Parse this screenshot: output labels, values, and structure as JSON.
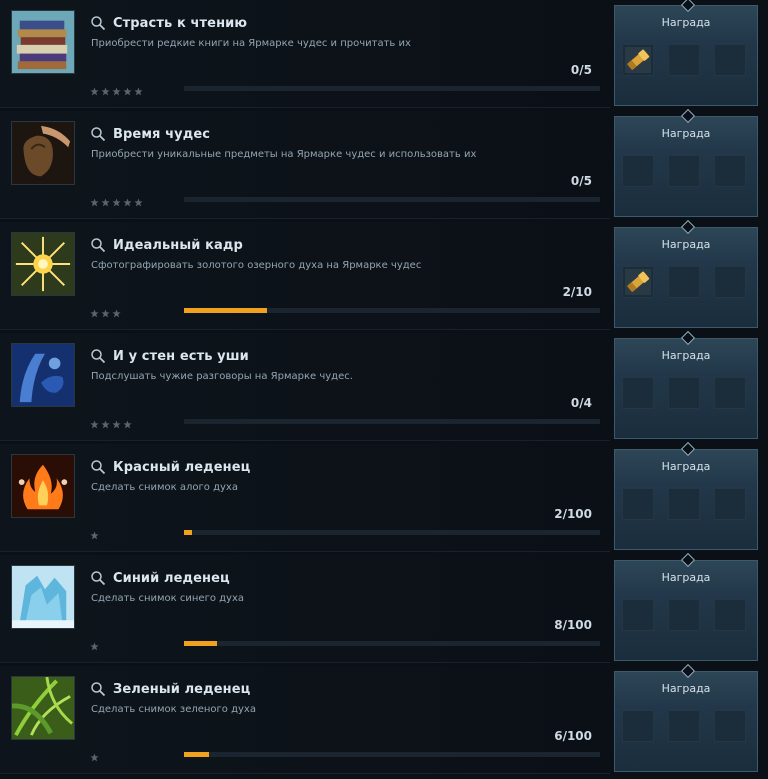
{
  "reward_label": "Награда",
  "accent_color": "#f0a11f",
  "achievements": [
    {
      "title": "Страсть к чтению",
      "description": "Приобрести редкие книги на Ярмарке чудес и прочитать их",
      "count": "0/5",
      "progress": 0.0,
      "stars": 5,
      "icon": "books-icon",
      "reward_icon": "spyglass-icon",
      "has_reward": true
    },
    {
      "title": "Время чудес",
      "description": "Приобрести уникальные предметы на Ярмарке чудес и использовать их",
      "count": "0/5",
      "progress": 0.0,
      "stars": 5,
      "icon": "hand-bag-icon",
      "reward_icon": "",
      "has_reward": false
    },
    {
      "title": "Идеальный кадр",
      "description": "Сфотографировать золотого озерного духа на Ярмарке чудес",
      "count": "2/10",
      "progress": 0.2,
      "stars": 3,
      "icon": "golden-spirit-icon",
      "reward_icon": "spyglass-icon",
      "has_reward": true
    },
    {
      "title": "И у стен есть уши",
      "description": "Подслушать чужие разговоры на Ярмарке чудес.",
      "count": "0/4",
      "progress": 0.0,
      "stars": 4,
      "icon": "listening-icon",
      "reward_icon": "",
      "has_reward": false
    },
    {
      "title": "Красный леденец",
      "description": "Сделать снимок алого духа",
      "count": "2/100",
      "progress": 0.02,
      "stars": 1,
      "icon": "red-fire-spirit-icon",
      "reward_icon": "",
      "has_reward": false
    },
    {
      "title": "Синий леденец",
      "description": "Сделать снимок синего духа",
      "count": "8/100",
      "progress": 0.08,
      "stars": 1,
      "icon": "ice-crystal-icon",
      "reward_icon": "",
      "has_reward": false
    },
    {
      "title": "Зеленый леденец",
      "description": "Сделать снимок зеленого духа",
      "count": "6/100",
      "progress": 0.06,
      "stars": 1,
      "icon": "jungle-leaves-icon",
      "reward_icon": "",
      "has_reward": false
    }
  ]
}
